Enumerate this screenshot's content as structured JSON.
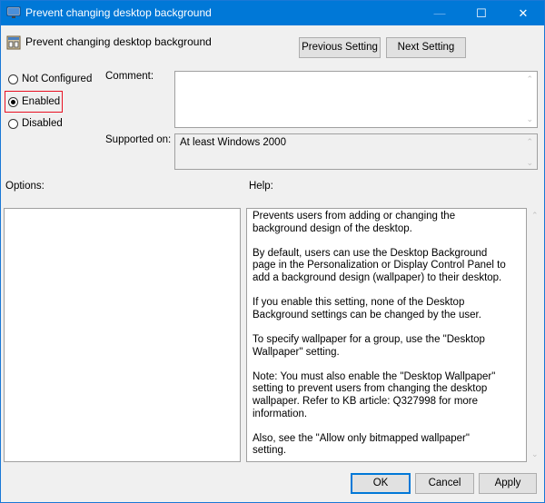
{
  "window": {
    "title": "Prevent changing desktop background",
    "controls": {
      "minimize": "—",
      "maximize": "☐",
      "close": "✕"
    }
  },
  "header": {
    "policy_name": "Prevent changing desktop background",
    "previous_label": "Previous Setting",
    "next_label": "Next Setting"
  },
  "state": {
    "options": [
      {
        "label": "Not Configured",
        "checked": false
      },
      {
        "label": "Enabled",
        "checked": true
      },
      {
        "label": "Disabled",
        "checked": false
      }
    ]
  },
  "comment": {
    "label": "Comment:",
    "value": ""
  },
  "supported": {
    "label": "Supported on:",
    "value": "At least Windows 2000"
  },
  "options_label": "Options:",
  "help": {
    "label": "Help:",
    "paragraphs": [
      "Prevents users from adding or changing the background design of the desktop.",
      "By default, users can use the Desktop Background page in the Personalization or Display Control Panel to add a background design (wallpaper) to their desktop.",
      "If you enable this setting, none of the Desktop Background settings can be changed by the user.",
      "To specify wallpaper for a group, use the \"Desktop Wallpaper\" setting.",
      "Note: You must also enable the \"Desktop Wallpaper\" setting to prevent users from changing the desktop wallpaper. Refer to KB article: Q327998 for more information.",
      "Also, see the \"Allow only bitmapped wallpaper\" setting."
    ]
  },
  "footer": {
    "ok_label": "OK",
    "cancel_label": "Cancel",
    "apply_label": "Apply"
  },
  "colors": {
    "titlebar": "#0078d7",
    "highlight": "#e81123",
    "background": "#f0f0f0"
  }
}
